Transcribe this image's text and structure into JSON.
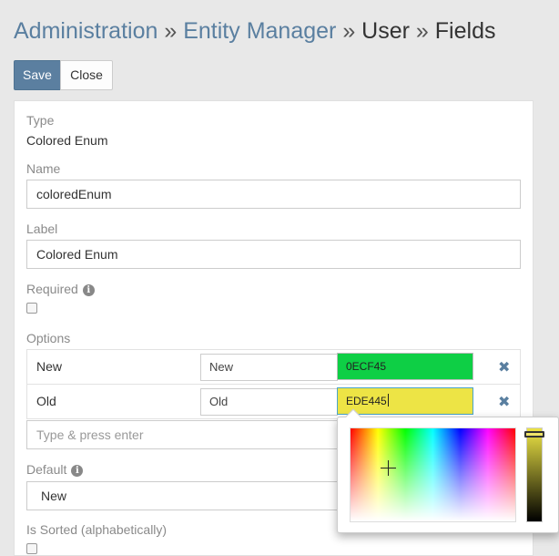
{
  "breadcrumb": {
    "items": [
      "Administration",
      "Entity Manager",
      "User",
      "Fields"
    ],
    "separator": "»"
  },
  "toolbar": {
    "save_label": "Save",
    "close_label": "Close"
  },
  "form": {
    "type_label": "Type",
    "type_value": "Colored Enum",
    "name_label": "Name",
    "name_value": "coloredEnum",
    "label_label": "Label",
    "label_value": "Colored Enum",
    "required_label": "Required",
    "options_label": "Options",
    "options": [
      {
        "name": "New",
        "label": "New",
        "color": "0ECF45",
        "color_hex": "#0ECF45"
      },
      {
        "name": "Old",
        "label": "Old",
        "color": "EDE445",
        "color_hex": "#EDE445"
      }
    ],
    "add_option_placeholder": "Type & press enter",
    "default_label": "Default",
    "default_value": "New",
    "sorted_label": "Is Sorted (alphabetically)"
  },
  "icons": {
    "info": "info-circle-icon",
    "remove": "times-icon"
  },
  "colors": {
    "accent": "#5b7fa0",
    "link": "#5a7fa0"
  }
}
